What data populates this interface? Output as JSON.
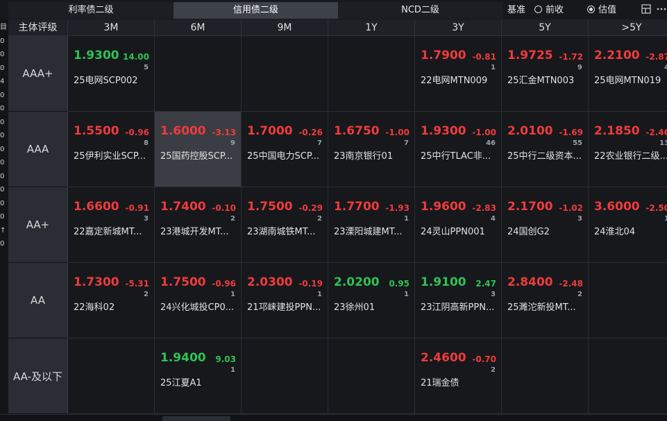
{
  "tabs": [
    {
      "label": "利率债二级"
    },
    {
      "label": "信用债二级"
    },
    {
      "label": "NCD二级"
    }
  ],
  "active_tab": 1,
  "benchmark": {
    "label": "基准",
    "options": [
      {
        "label": "前收",
        "selected": false
      },
      {
        "label": "估值",
        "selected": true
      }
    ]
  },
  "left_strip": [
    "目",
    "0",
    "0",
    "0",
    "4",
    "0",
    "0",
    "0",
    "0",
    "0",
    "0",
    "0",
    "0",
    "0",
    "0",
    "↑",
    "0"
  ],
  "header": {
    "corner": "主体评级",
    "tenors": [
      "3M",
      "6M",
      "9M",
      "1Y",
      "3Y",
      "5Y",
      ">5Y"
    ]
  },
  "rows": [
    {
      "rating": "AAA+",
      "cells": [
        {
          "yield": "1.9300",
          "change": "14.00",
          "count": "5",
          "name": "25电网SCP002",
          "dir": "dn"
        },
        null,
        null,
        null,
        {
          "yield": "1.7900",
          "change": "-0.81",
          "count": "1",
          "name": "22电网MTN009",
          "dir": "up"
        },
        {
          "yield": "1.9725",
          "change": "-1.72",
          "count": "9",
          "name": "25汇金MTN003",
          "dir": "up"
        },
        {
          "yield": "2.2100",
          "change": "-2.87",
          "count": "4",
          "name": "25电网MTN019",
          "dir": "up"
        }
      ]
    },
    {
      "rating": "AAA",
      "cells": [
        {
          "yield": "1.5500",
          "change": "-0.96",
          "count": "8",
          "name": "25伊利实业SCP...",
          "dir": "up"
        },
        {
          "yield": "1.6000",
          "change": "-3.13",
          "count": "9",
          "name": "25国药控股SCP...",
          "dir": "up",
          "selected": true
        },
        {
          "yield": "1.7000",
          "change": "-0.26",
          "count": "7",
          "name": "25中国电力SCP...",
          "dir": "up"
        },
        {
          "yield": "1.6750",
          "change": "-1.00",
          "count": "7",
          "name": "23南京银行01",
          "dir": "up"
        },
        {
          "yield": "1.9300",
          "change": "-1.00",
          "count": "46",
          "name": "25中行TLAC非...",
          "dir": "up"
        },
        {
          "yield": "2.0100",
          "change": "-1.69",
          "count": "55",
          "name": "25中行二级资本...",
          "dir": "up"
        },
        {
          "yield": "2.1850",
          "change": "-2.46",
          "count": "13",
          "name": "22农业银行二级...",
          "dir": "up"
        }
      ]
    },
    {
      "rating": "AA+",
      "cells": [
        {
          "yield": "1.6600",
          "change": "-0.91",
          "count": "3",
          "name": "22嘉定新城MT...",
          "dir": "up"
        },
        {
          "yield": "1.7400",
          "change": "-0.10",
          "count": "2",
          "name": "23港城开发MT...",
          "dir": "up"
        },
        {
          "yield": "1.7500",
          "change": "-0.29",
          "count": "2",
          "name": "23湖南城铁MT...",
          "dir": "up"
        },
        {
          "yield": "1.7700",
          "change": "-1.93",
          "count": "1",
          "name": "23溧阳城建MT...",
          "dir": "up"
        },
        {
          "yield": "1.9600",
          "change": "-2.83",
          "count": "4",
          "name": "24灵山PPN001",
          "dir": "up"
        },
        {
          "yield": "2.1700",
          "change": "-1.02",
          "count": "3",
          "name": "24国创G2",
          "dir": "up"
        },
        {
          "yield": "3.6000",
          "change": "-2.50",
          "count": "1",
          "name": "24淮北04",
          "dir": "up"
        }
      ]
    },
    {
      "rating": "AA",
      "cells": [
        {
          "yield": "1.7300",
          "change": "-5.31",
          "count": "2",
          "name": "22海科02",
          "dir": "up"
        },
        {
          "yield": "1.7500",
          "change": "-0.96",
          "count": "1",
          "name": "24兴化城投CP0...",
          "dir": "up"
        },
        {
          "yield": "2.0300",
          "change": "-0.19",
          "count": "1",
          "name": "21邛崃建投PPN...",
          "dir": "up"
        },
        {
          "yield": "2.0200",
          "change": "0.95",
          "count": "1",
          "name": "23徐州01",
          "dir": "dn"
        },
        {
          "yield": "1.9100",
          "change": "2.47",
          "count": "3",
          "name": "23江阴高新PPN...",
          "dir": "dn"
        },
        {
          "yield": "2.8400",
          "change": "-2.48",
          "count": "2",
          "name": "25濉沱新投MT...",
          "dir": "up"
        },
        null
      ]
    },
    {
      "rating": "AA-及以下",
      "cells": [
        null,
        {
          "yield": "1.9400",
          "change": "9.03",
          "count": "1",
          "name": "25江夏A1",
          "dir": "dn"
        },
        null,
        null,
        {
          "yield": "2.4600",
          "change": "-0.70",
          "count": "2",
          "name": "21瑞金债",
          "dir": "up"
        },
        null,
        null
      ]
    }
  ]
}
